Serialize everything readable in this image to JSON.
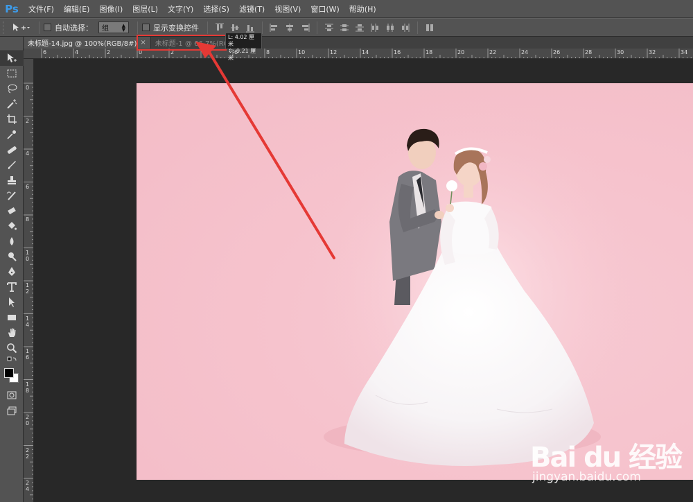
{
  "app": {
    "logo": "Ps"
  },
  "menu": [
    "文件(F)",
    "编辑(E)",
    "图像(I)",
    "图层(L)",
    "文字(Y)",
    "选择(S)",
    "滤镜(T)",
    "视图(V)",
    "窗口(W)",
    "帮助(H)"
  ],
  "options": {
    "auto_select_label": "自动选择：",
    "auto_select_value": "组",
    "show_transform_label": "显示变换控件"
  },
  "tabs": [
    {
      "label": "未标题-14.jpg @ 100%(RGB/8#)",
      "close": "×"
    },
    {
      "label": "未标题-1 @ 66.7%(RGB"
    }
  ],
  "tooltip": {
    "line1": "L: 4.02 厘米",
    "line2": "⇕: 9.21 厘米"
  },
  "ruler": {
    "h_labels": [
      "6",
      "4",
      "2",
      "0",
      "2",
      "4",
      "6",
      "8",
      "10",
      "12",
      "14",
      "16",
      "18",
      "20",
      "22",
      "24",
      "26",
      "28",
      "30",
      "32",
      "34"
    ],
    "v_labels": [
      "0",
      "2",
      "4",
      "6",
      "8",
      "10",
      "12",
      "14",
      "16",
      "18",
      "20",
      "22",
      "24"
    ]
  },
  "tools": [
    "move-tool-icon",
    "marquee-tool-icon",
    "lasso-tool-icon",
    "magic-wand-icon",
    "crop-tool-icon",
    "eyedropper-icon",
    "healing-brush-icon",
    "brush-tool-icon",
    "clone-stamp-icon",
    "history-brush-icon",
    "eraser-icon",
    "paint-bucket-icon",
    "blur-tool-icon",
    "dodge-tool-icon",
    "pen-tool-icon",
    "type-tool-icon",
    "path-selection-icon",
    "rectangle-tool-icon",
    "hand-tool-icon",
    "zoom-tool-icon"
  ],
  "watermark": {
    "brand": "Bai du 经验",
    "url": "jingyan.baidu.com"
  },
  "colors": {
    "annotation": "#e53935",
    "photo_bg": "#f6c3cd"
  }
}
